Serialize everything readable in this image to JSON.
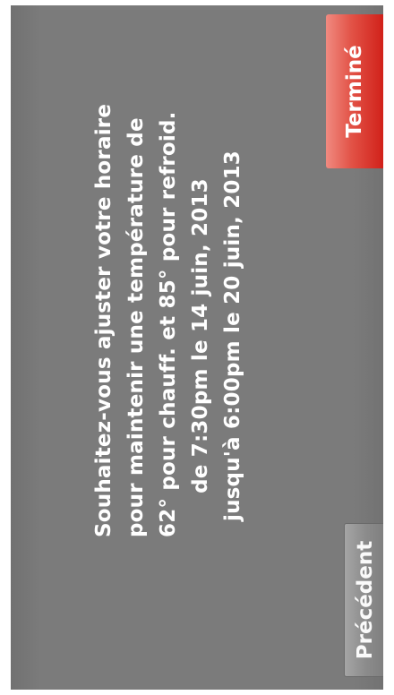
{
  "dialog": {
    "message_lines": [
      "Souhaitez-vous ajuster votre horaire",
      "pour maintenir une température de",
      "62° pour chauff. et 85° pour refroid.",
      "de 7:30pm le 14 juin, 2013",
      "jusqu'à 6:00pm le 20 juin, 2013"
    ]
  },
  "buttons": {
    "back_label": "Précédent",
    "done_label": "Terminé"
  },
  "colors": {
    "background": "#7b7b7b",
    "done_button": "#d1211a",
    "back_button": "#8c8c8c",
    "text": "#ffffff"
  }
}
